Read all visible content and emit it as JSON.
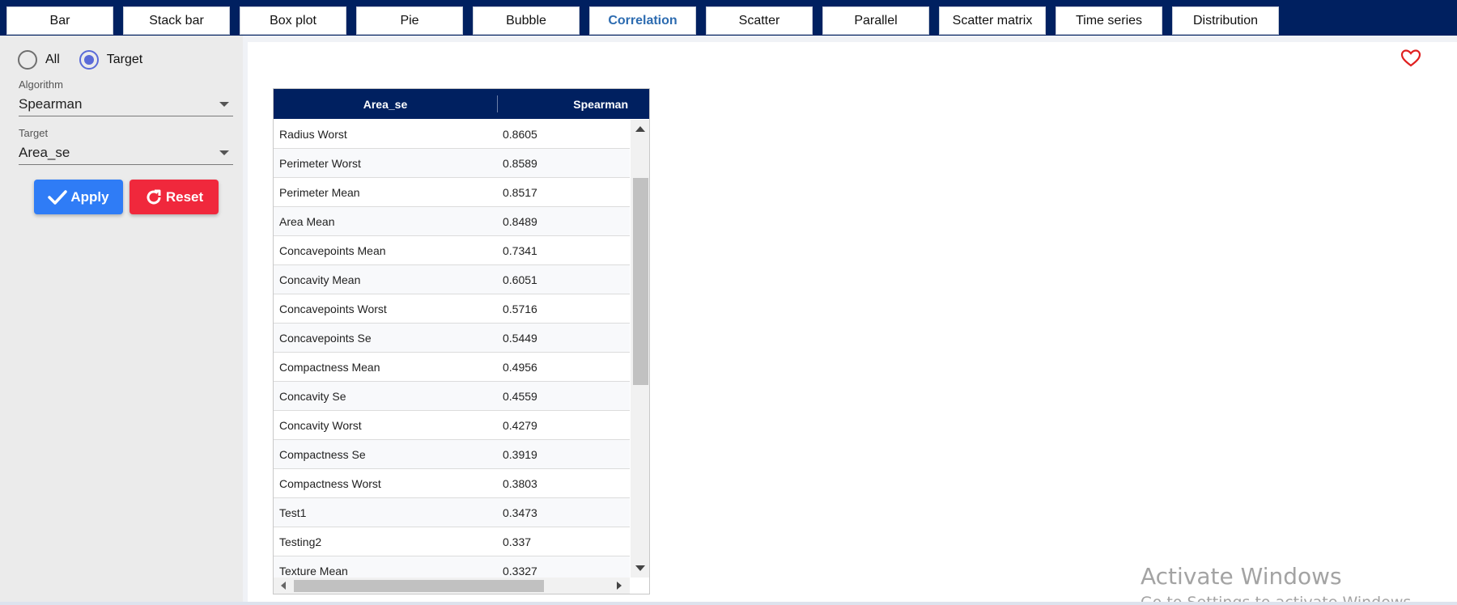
{
  "tabs": [
    {
      "label": "Bar",
      "active": false
    },
    {
      "label": "Stack bar",
      "active": false
    },
    {
      "label": "Box plot",
      "active": false
    },
    {
      "label": "Pie",
      "active": false
    },
    {
      "label": "Bubble",
      "active": false
    },
    {
      "label": "Correlation",
      "active": true
    },
    {
      "label": "Scatter",
      "active": false
    },
    {
      "label": "Parallel",
      "active": false
    },
    {
      "label": "Scatter matrix",
      "active": false
    },
    {
      "label": "Time series",
      "active": false
    },
    {
      "label": "Distribution",
      "active": false
    }
  ],
  "sidebar": {
    "radio_all": "All",
    "radio_target": "Target",
    "selected_radio": "Target",
    "algorithm_label": "Algorithm",
    "algorithm_value": "Spearman",
    "target_label": "Target",
    "target_value": "Area_se",
    "apply_label": "Apply",
    "reset_label": "Reset"
  },
  "colors": {
    "nav": "#002060",
    "apply": "#2f7cf6",
    "reset": "#f0283c",
    "heart": "#e02020"
  },
  "table": {
    "headers": [
      "Area_se",
      "Spearman"
    ],
    "rows": [
      [
        "Radius Worst",
        "0.8605"
      ],
      [
        "Perimeter Worst",
        "0.8589"
      ],
      [
        "Perimeter Mean",
        "0.8517"
      ],
      [
        "Area Mean",
        "0.8489"
      ],
      [
        "Concavepoints Mean",
        "0.7341"
      ],
      [
        "Concavity Mean",
        "0.6051"
      ],
      [
        "Concavepoints Worst",
        "0.5716"
      ],
      [
        "Concavepoints Se",
        "0.5449"
      ],
      [
        "Compactness Mean",
        "0.4956"
      ],
      [
        "Concavity Se",
        "0.4559"
      ],
      [
        "Concavity Worst",
        "0.4279"
      ],
      [
        "Compactness Se",
        "0.3919"
      ],
      [
        "Compactness Worst",
        "0.3803"
      ],
      [
        "Test1",
        "0.3473"
      ],
      [
        "Testing2",
        "0.337"
      ],
      [
        "Texture Mean",
        "0.3327"
      ]
    ]
  },
  "watermark": {
    "line1": "Activate Windows",
    "line2": "Go to Settings to activate Windows."
  },
  "icons": {
    "favorite": "heart-outline-icon",
    "apply": "checkmark-icon",
    "reset": "refresh-icon"
  }
}
